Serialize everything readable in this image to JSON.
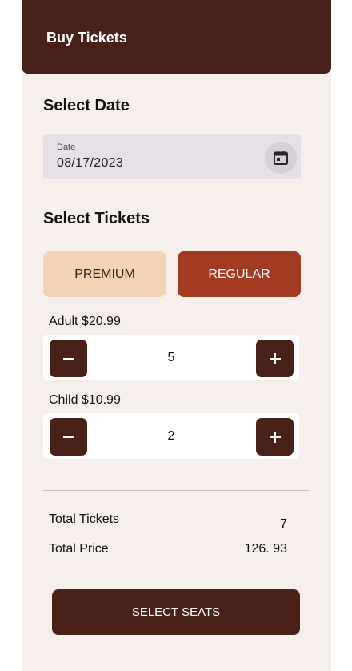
{
  "appbar": {
    "title": "Buy Tickets"
  },
  "date_section": {
    "title": "Select Date",
    "field_label": "Date",
    "field_value": "08/17/2023",
    "icon": "calendar-icon"
  },
  "tickets_section": {
    "title": "Select Tickets",
    "tabs": [
      {
        "label": "PREMIUM",
        "selected": false
      },
      {
        "label": "REGULAR",
        "selected": true
      }
    ],
    "rows": [
      {
        "label": "Adult  $20.99",
        "count": "5"
      },
      {
        "label": "Child  $10.99",
        "count": "2"
      }
    ]
  },
  "summary": {
    "tickets_label": "Total Tickets",
    "tickets_value": "7",
    "price_label": "Total Price",
    "price_value": "126. 93"
  },
  "action": {
    "label": "SELECT SEATS"
  },
  "colors": {
    "primary": "#4a2119",
    "accent": "#a53a22",
    "tab_unselected": "#f2d5b6",
    "background": "#f6efec"
  }
}
